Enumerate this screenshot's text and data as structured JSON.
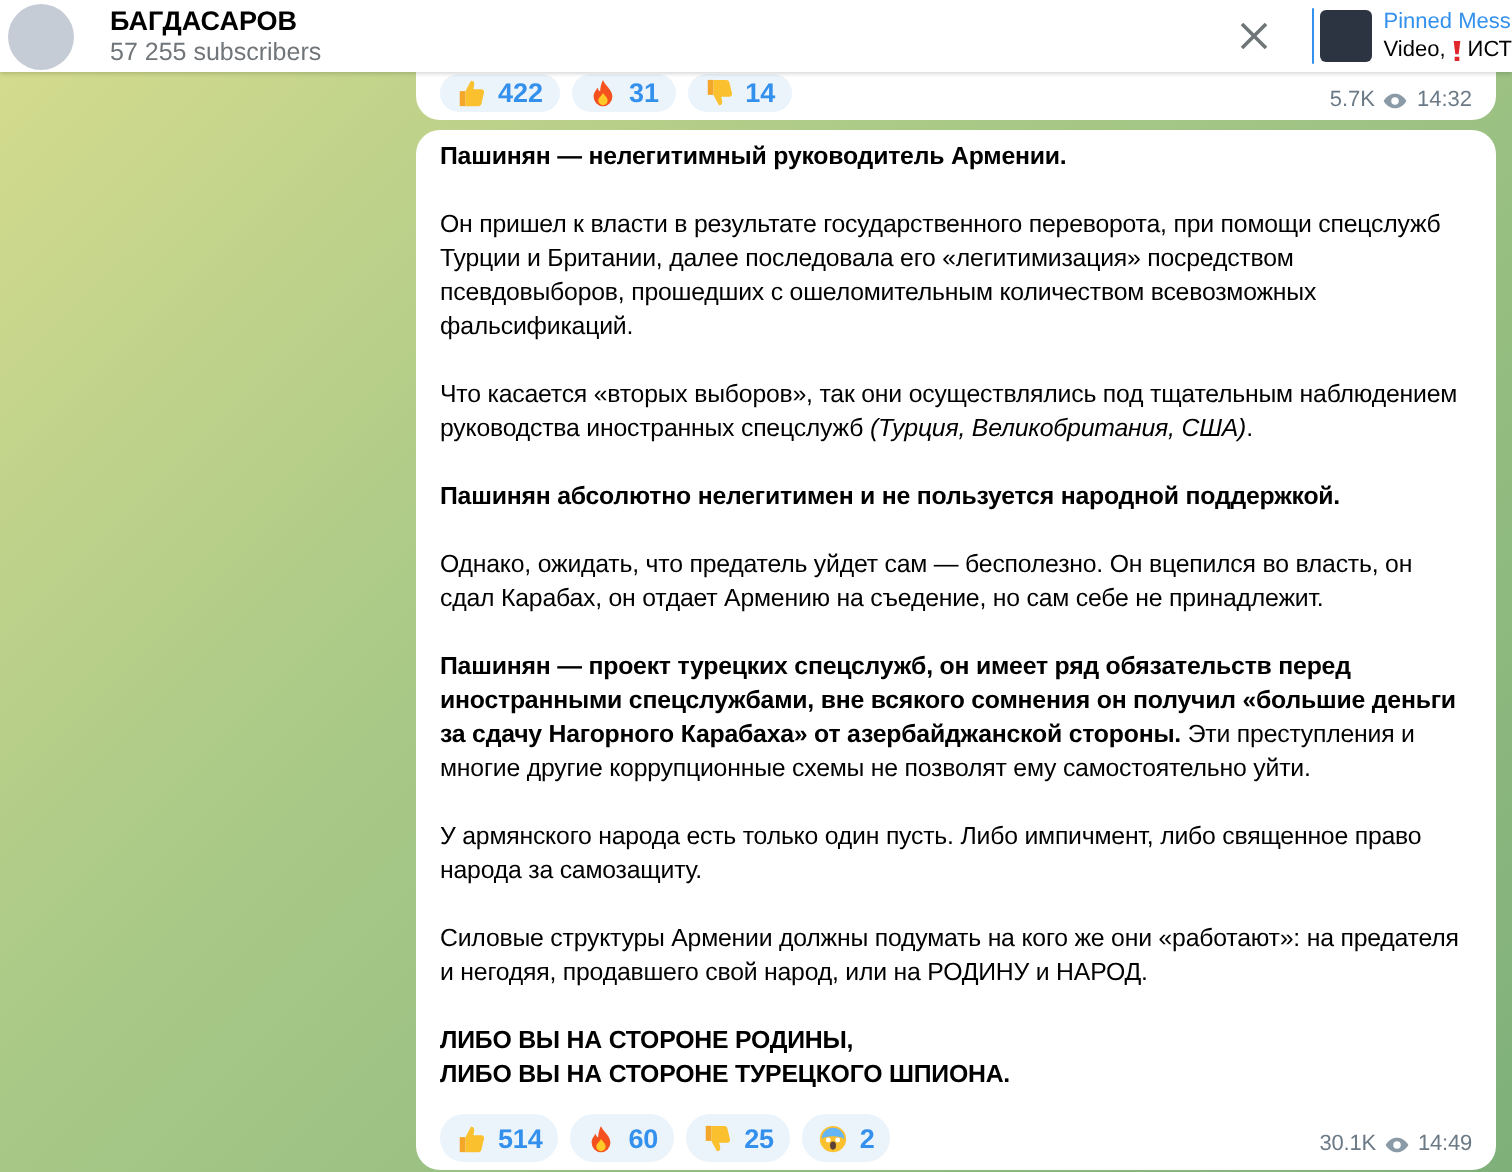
{
  "header": {
    "channel_name": "БАГДАСАРОВ",
    "subscribers": "57 255 subscribers",
    "pinned": {
      "title": "Pinned Mess",
      "prefix": "Video,",
      "suffix": "ИСТ"
    }
  },
  "previous_message": {
    "reactions": [
      {
        "kind": "thumbs-up",
        "count": "422"
      },
      {
        "kind": "fire",
        "count": "31"
      },
      {
        "kind": "thumbs-down",
        "count": "14"
      }
    ],
    "views": "5.7K",
    "time": "14:32"
  },
  "message": {
    "paragraphs": [
      {
        "text": "Пашинян — нелегитимный руководитель Армении.",
        "bold": true
      },
      {
        "text": "Он пришел к власти в результате государственного переворота, при помощи спецслужб Турции и Британии, далее последовала его «легитимизация» посредством псевдовыборов, прошедших с ошеломительным количеством всевозможных фальсификаций.",
        "bold": false
      },
      {
        "text": "Что касается «вторых выборов», так они осуществлялись под тщательным наблюдением руководства иностранных спецслужб *(Турция, Великобритания, США)*.",
        "bold": false
      },
      {
        "text": "Пашинян абсолютно нелегитимен и не пользуется народной поддержкой.",
        "bold": true
      },
      {
        "text": "Однако, ожидать, что предатель уйдет сам — бесполезно. Он вцепился во власть, он сдал Карабах, он отдает Армению на съедение, но сам себе не принадлежит.",
        "bold": false
      },
      {
        "text": "**Пашинян — проект турецких спецслужб, он имеет ряд обязательств перед иностранными спецслужбами, вне всякого сомнения он получил «большие деньги за сдачу Нагорного Карабаха» от азербайджанской стороны.** Эти преступления и многие другие коррупционные схемы не позволят ему самостоятельно уйти.",
        "bold": false
      },
      {
        "text": "У армянского народа есть только один пусть. Либо импичмент, либо священное право народа за самозащиту.",
        "bold": false
      },
      {
        "text": "Силовые структуры Армении должны подумать на кого же они «работают»: на предателя и негодяя, продавшего свой народ, или на РОДИНУ и НАРОД.",
        "bold": false
      },
      {
        "lines": [
          "ЛИБО ВЫ НА СТОРОНЕ РОДИНЫ,",
          "ЛИБО ВЫ НА СТОРОНЕ ТУРЕЦКОГО ШПИОНА."
        ],
        "bold": true
      }
    ],
    "reactions": [
      {
        "kind": "thumbs-up",
        "count": "514"
      },
      {
        "kind": "fire",
        "count": "60"
      },
      {
        "kind": "thumbs-down",
        "count": "25"
      },
      {
        "kind": "scream",
        "count": "2"
      }
    ],
    "views": "30.1K",
    "time": "14:49"
  }
}
